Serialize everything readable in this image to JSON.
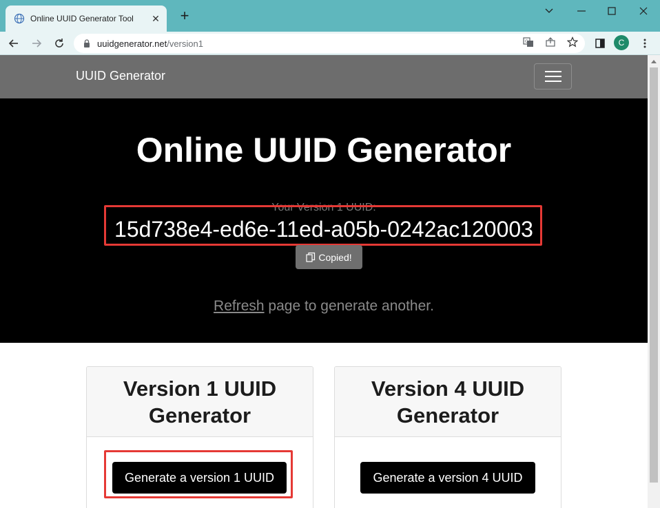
{
  "browser": {
    "tab_title": "Online UUID Generator Tool",
    "url_host": "uuidgenerator.net",
    "url_path": "/version1",
    "profile_initial": "C"
  },
  "navbar": {
    "brand": "UUID Generator"
  },
  "hero": {
    "title": "Online UUID Generator",
    "uuid_caption": "Your Version 1 UUID:",
    "uuid_value": "15d738e4-ed6e-11ed-a05b-0242ac120003",
    "copied_label": "Copied!",
    "refresh_link": "Refresh",
    "refresh_suffix": " page to generate another."
  },
  "cards": [
    {
      "title_line1": "Version 1 UUID",
      "title_line2": "Generator",
      "button": "Generate a version 1 UUID"
    },
    {
      "title_line1": "Version 4 UUID",
      "title_line2": "Generator",
      "button": "Generate a version 4 UUID"
    }
  ],
  "colors": {
    "highlight": "#e53935",
    "titlebar": "#5fb7bd",
    "navbar": "#6d6d6d",
    "hero": "#000000"
  }
}
